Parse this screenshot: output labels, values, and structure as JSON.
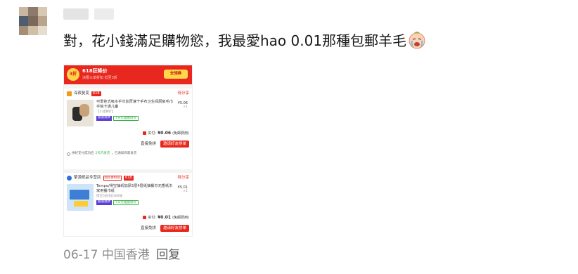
{
  "comment": {
    "text": "對，花小錢滿足購物慾，我最愛hao 0.01那種包郵羊毛",
    "emoji": "crying-face-emoji",
    "date": "06-17",
    "location": "中国香港",
    "reply_label": "回复"
  },
  "screenshot": {
    "banner": {
      "badge": "3折",
      "title": "618狂降价",
      "subtitle": "决限三单折扣 低至3折",
      "coupon_button": "去领券"
    },
    "orders": [
      {
        "shop": "深夜复变",
        "tag": "618",
        "status": "待分享",
        "item_title": "可爱挂式吸水手巾加厚速干手布卫生间厨房毛巾手帕卡通儿童",
        "item_sub": "【小桌稀扩】",
        "price": "¥5.06",
        "qty": "×1",
        "chip1": "极速退款",
        "chip2": "7天无理由退货",
        "paid_label": "实付:",
        "paid_amount": "¥0.06",
        "paid_note": "(免邮费用)",
        "btn1": "直接免拼",
        "btn2": "邀请好友拼单",
        "notice_pre": "拼好支付成功后",
        "notice_green": "2天内发货",
        "notice_post": "，已通知商家发货"
      },
      {
        "shop": "擎源纸品专营店",
        "tag_extra": "回头客好店",
        "tag": "618",
        "status": "待分享",
        "item_title": "Tempo/得宝抽纸加厚5层4层纸抽餐巾无香纸巾家用餐巾纸",
        "item_sub": "得宝5层4层160抽",
        "price": "¥5.01",
        "qty": "×1",
        "chip1": "极速退款",
        "chip2": "7天无理由退货",
        "paid_label": "实付:",
        "paid_amount": "¥0.01",
        "paid_note": "(免邮费用)",
        "btn1": "直接免拼",
        "btn2": "邀请好友拼单"
      }
    ]
  },
  "colors": {
    "accent_red": "#e8281e",
    "meta_gray": "#8c8c8c"
  }
}
